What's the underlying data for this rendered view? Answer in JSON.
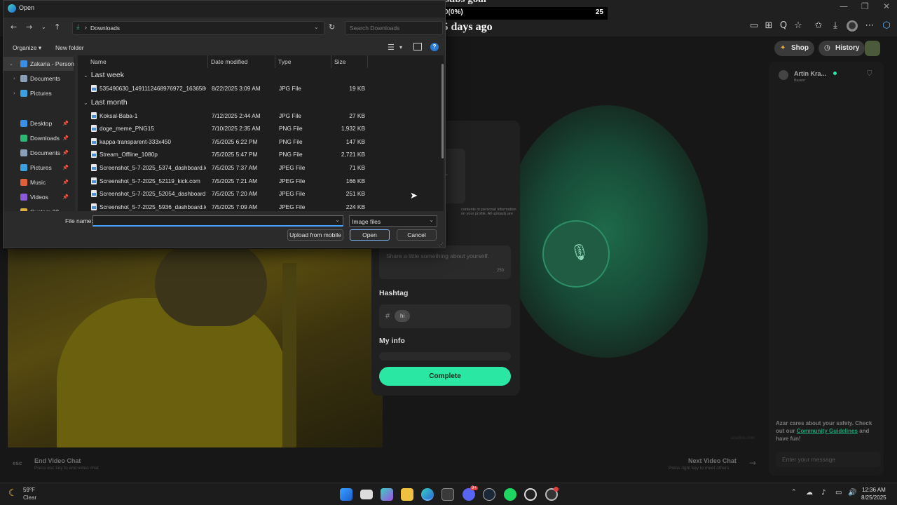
{
  "browser": {
    "address_glyph": "Q",
    "extensions_glyph": "⬡"
  },
  "goal_overlay": {
    "title": "monthly subs goal",
    "start": "0",
    "progress": "0(0%)",
    "target": "25",
    "status": "Ended 15 days ago"
  },
  "site": {
    "shop_label": "Shop",
    "history_label": "History",
    "partner": {
      "name": "Artin Kra...",
      "sub": "Baserrr"
    },
    "card": {
      "upload_note": "contents or personal information on your profile. All uploads are",
      "bio_placeholder": "Share a little something about yourself.",
      "bio_counter": "250",
      "hashtag_title": "Hashtag",
      "hashtag_hash": "#",
      "hashtag_tag": "hi",
      "myinfo_title": "My info",
      "complete_label": "Complete"
    },
    "watermark": "azarlive.com",
    "safety_text_1": "Azar cares about your safety.",
    "safety_text_2": "Check out our",
    "safety_link": "Community Guidelines",
    "safety_text_3": "and have fun!",
    "message_placeholder": "Enter your message",
    "esc_key": "esc",
    "end_chat_title": "End Video Chat",
    "end_chat_hint": "Press esc key to end video chat",
    "next_chat_title": "Next Video Chat",
    "next_chat_hint": "Press right key to meet others",
    "next_arrow": "→"
  },
  "dialog": {
    "title": "Open",
    "breadcrumb": "Downloads",
    "search_placeholder": "Search Downloads",
    "organize_label": "Organize ▾",
    "new_folder_label": "New folder",
    "nav_items": [
      {
        "label": "Zakaria - Person",
        "color": "#3a8ee6",
        "pin": ""
      },
      {
        "label": "Documents",
        "color": "#8aa0b8",
        "pin": ""
      },
      {
        "label": "Pictures",
        "color": "#3aa0e0",
        "pin": ""
      },
      {
        "label": "Desktop",
        "color": "#3a8ee6",
        "pin": "📌"
      },
      {
        "label": "Downloads",
        "color": "#2bb673",
        "pin": "📌"
      },
      {
        "label": "Documents",
        "color": "#8aa0b8",
        "pin": "📌"
      },
      {
        "label": "Pictures",
        "color": "#3aa0e0",
        "pin": "📌"
      },
      {
        "label": "Music",
        "color": "#e0603a",
        "pin": "📌"
      },
      {
        "label": "Videos",
        "color": "#8a5ad8",
        "pin": "📌"
      },
      {
        "label": "Custom 22",
        "color": "#e0b040",
        "pin": ""
      }
    ],
    "columns": {
      "name": "Name",
      "date": "Date modified",
      "type": "Type",
      "size": "Size"
    },
    "groups": [
      {
        "label": "Last week",
        "files": [
          {
            "name": "535490630_1491112468976972_163658661...",
            "date": "8/22/2025 3:09 AM",
            "type": "JPG File",
            "size": "19 KB"
          }
        ]
      },
      {
        "label": "Last month",
        "files": [
          {
            "name": "Koksal-Baba-1",
            "date": "7/12/2025 2:44 AM",
            "type": "JPG File",
            "size": "27 KB"
          },
          {
            "name": "doge_meme_PNG15",
            "date": "7/10/2025 2:35 AM",
            "type": "PNG File",
            "size": "1,932 KB"
          },
          {
            "name": "kappa-transparent-333x450",
            "date": "7/5/2025 6:22 PM",
            "type": "PNG File",
            "size": "147 KB"
          },
          {
            "name": "Stream_Offline_1080p",
            "date": "7/5/2025 5:47 PM",
            "type": "PNG File",
            "size": "2,721 KB"
          },
          {
            "name": "Screenshot_5-7-2025_5374_dashboard.kic...",
            "date": "7/5/2025 7:37 AM",
            "type": "JPEG File",
            "size": "71 KB"
          },
          {
            "name": "Screenshot_5-7-2025_52119_kick.com",
            "date": "7/5/2025 7:21 AM",
            "type": "JPEG File",
            "size": "166 KB"
          },
          {
            "name": "Screenshot_5-7-2025_52054_dashboard.ki...",
            "date": "7/5/2025 7:20 AM",
            "type": "JPEG File",
            "size": "251 KB"
          },
          {
            "name": "Screenshot_5-7-2025_5936_dashboard.kic...",
            "date": "7/5/2025 7:09 AM",
            "type": "JPEG File",
            "size": "224 KB"
          }
        ]
      }
    ],
    "filename_label": "File name:",
    "filename_value": "",
    "filetype_value": "Image files",
    "upload_mobile_label": "Upload from mobile",
    "open_label": "Open",
    "cancel_label": "Cancel",
    "help_glyph": "?"
  },
  "taskbar": {
    "weather_temp": "59°F",
    "weather_desc": "Clear",
    "time": "12:36 AM",
    "date": "8/25/2025",
    "discord_badge": "9+"
  }
}
